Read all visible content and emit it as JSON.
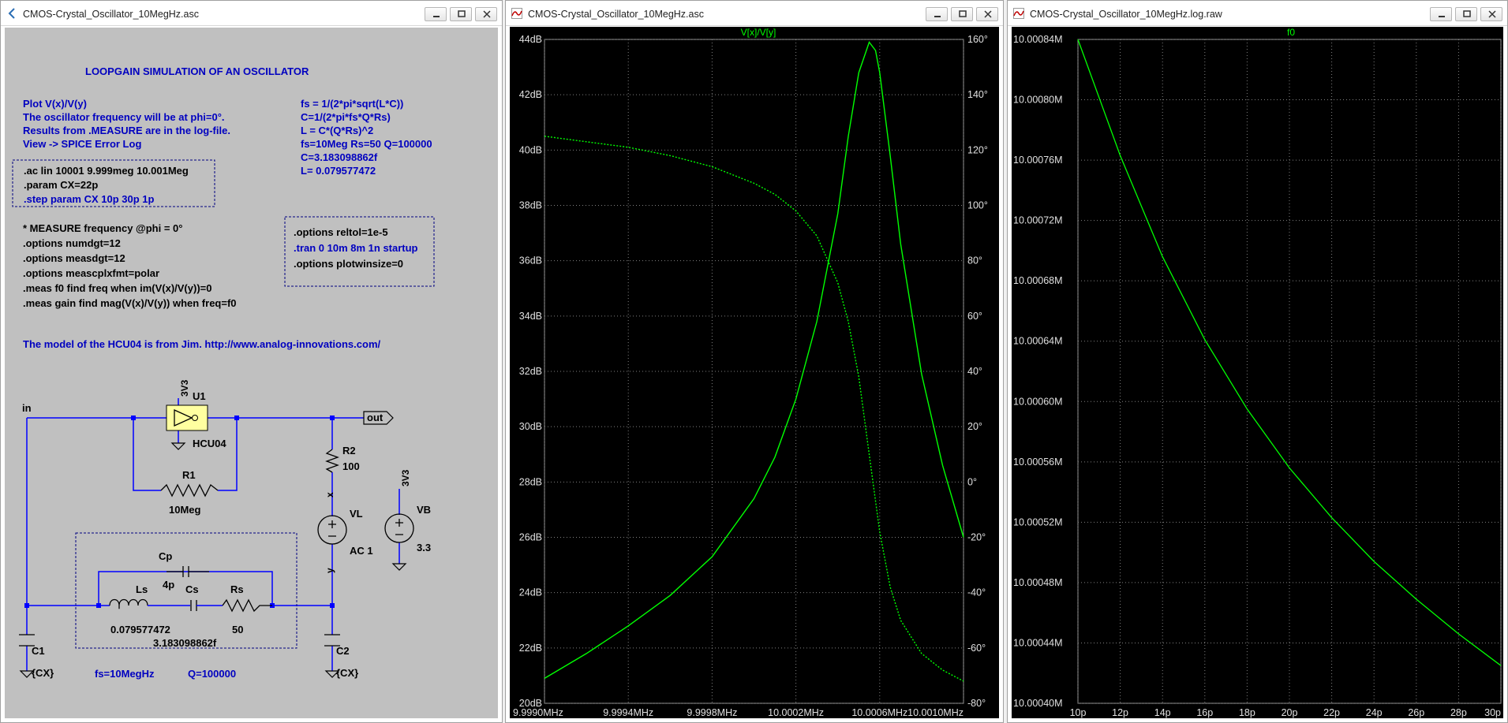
{
  "windows": {
    "schematic": {
      "title": "CMOS-Crystal_Oscillator_10MegHz.asc"
    },
    "ac_plot": {
      "title": "CMOS-Crystal_Oscillator_10MegHz.asc"
    },
    "log_plot": {
      "title": "CMOS-Crystal_Oscillator_10MegHz.log.raw"
    }
  },
  "schematic": {
    "heading": "LOOPGAIN SIMULATION OF AN OSCILLATOR",
    "notes_left": [
      "Plot V(x)/V(y)",
      "The oscillator frequency will be at phi=0°.",
      "Results from .MEASURE are in the log-file.",
      "View -> SPICE Error Log"
    ],
    "notes_right": [
      "fs = 1/(2*pi*sqrt(L*C))",
      "C=1/(2*pi*fs*Q*Rs)",
      "L = C*(Q*Rs)^2",
      "fs=10Meg Rs=50 Q=100000",
      "C=3.183098862f",
      "L= 0.079577472"
    ],
    "directives_box1": [
      ".ac lin 10001 9.999meg 10.001Meg",
      ".param CX=22p",
      ".step param CX 10p 30p 1p"
    ],
    "directives_box2": [
      ".options reltol=1e-5",
      ".tran 0 10m 8m 1n startup",
      ".options plotwinsize=0"
    ],
    "measure_lines": [
      "* MEASURE frequency @phi = 0°",
      ".options numdgt=12",
      ".options measdgt=12",
      ".options meascplxfmt=polar",
      ".meas f0 find freq when im(V(x)/V(y))=0",
      ".meas gain  find mag(V(x)/V(y)) when freq=f0"
    ],
    "model_note": "The model of the HCU04 is from Jim.  http://www.analog-innovations.com/",
    "labels": {
      "in": "in",
      "out": "out",
      "u1_supply": "3V3",
      "u1": "U1",
      "u1_model": "HCU04",
      "r1": "R1",
      "r1_val": "10Meg",
      "r2": "R2",
      "r2_val": "100",
      "x": "x",
      "y": "y",
      "vl": "VL",
      "vl_val": "AC 1",
      "vb_supply": "3V3",
      "vb": "VB",
      "vb_val": "3.3",
      "cp": "Cp",
      "cp_val": "4p",
      "ls": "Ls",
      "ls_val": "0.079577472",
      "cs": "Cs",
      "cs_val": "3.183098862f",
      "rs": "Rs",
      "rs_val": "50",
      "c1": "C1",
      "c1_val": "{CX}",
      "c2": "C2",
      "c2_val": "{CX}",
      "fs_note": "fs=10MegHz",
      "q_note": "Q=100000"
    }
  },
  "ac_plot": {
    "title": "V[x]/V[y]",
    "y_ticks": [
      "44dB",
      "42dB",
      "40dB",
      "38dB",
      "36dB",
      "34dB",
      "32dB",
      "30dB",
      "28dB",
      "26dB",
      "24dB",
      "22dB",
      "20dB"
    ],
    "y2_ticks": [
      "160°",
      "140°",
      "120°",
      "100°",
      "80°",
      "60°",
      "40°",
      "20°",
      "0°",
      "-20°",
      "-40°",
      "-60°",
      "-80°"
    ],
    "x_ticks": [
      "9.9990MHz",
      "9.9994MHz",
      "9.9998MHz",
      "10.0002MHz",
      "10.0006MHz",
      "10.0010MHz"
    ]
  },
  "log_plot": {
    "title": "f0",
    "y_ticks": [
      "10.00084M",
      "10.00080M",
      "10.00076M",
      "10.00072M",
      "10.00068M",
      "10.00064M",
      "10.00060M",
      "10.00056M",
      "10.00052M",
      "10.00048M",
      "10.00044M",
      "10.00040M"
    ],
    "x_ticks": [
      "10p",
      "12p",
      "14p",
      "16p",
      "18p",
      "20p",
      "22p",
      "24p",
      "26p",
      "28p",
      "30p"
    ]
  },
  "chart_data": [
    {
      "type": "line",
      "title": "V[x]/V[y]",
      "xlim": [
        9.999,
        10.001
      ],
      "ylim": [
        20,
        44
      ],
      "y2lim": [
        -80,
        160
      ],
      "grid": true,
      "series": [
        {
          "axis": "left",
          "style": "solid",
          "color": "#00ff00",
          "x": [
            9.999,
            9.9992,
            9.9994,
            9.9996,
            9.9998,
            10.0,
            10.0001,
            10.0002,
            10.0003,
            10.0004,
            10.00045,
            10.0005,
            10.00055,
            10.00058,
            10.0006,
            10.00065,
            10.0007,
            10.0008,
            10.0009,
            10.001
          ],
          "y": [
            20.9,
            21.8,
            22.8,
            23.9,
            25.3,
            27.4,
            28.9,
            31.0,
            33.8,
            37.7,
            40.5,
            42.8,
            43.9,
            43.6,
            42.8,
            39.8,
            36.6,
            31.9,
            28.6,
            26.0
          ]
        },
        {
          "axis": "right",
          "style": "dotted",
          "color": "#00ff00",
          "x": [
            9.999,
            9.9992,
            9.9994,
            9.9996,
            9.9998,
            10.0,
            10.0001,
            10.0002,
            10.0003,
            10.0004,
            10.00045,
            10.0005,
            10.00055,
            10.0006,
            10.00065,
            10.0007,
            10.0008,
            10.0009,
            10.001
          ],
          "y": [
            125,
            123,
            121,
            118,
            114,
            108,
            104,
            98,
            89,
            72,
            58,
            38,
            10,
            -18,
            -38,
            -50,
            -62,
            -68,
            -72
          ]
        }
      ]
    },
    {
      "type": "line",
      "title": "f0",
      "xlim": [
        10,
        30
      ],
      "ylim": [
        10.0004,
        10.00084
      ],
      "grid": true,
      "series": [
        {
          "color": "#00ff00",
          "x": [
            10,
            12,
            14,
            16,
            18,
            20,
            22,
            24,
            26,
            28,
            30
          ],
          "y": [
            10.00084,
            10.000763,
            10.000696,
            10.000641,
            10.000595,
            10.000556,
            10.000523,
            10.000494,
            10.000469,
            10.000446,
            10.000425
          ]
        }
      ]
    }
  ]
}
